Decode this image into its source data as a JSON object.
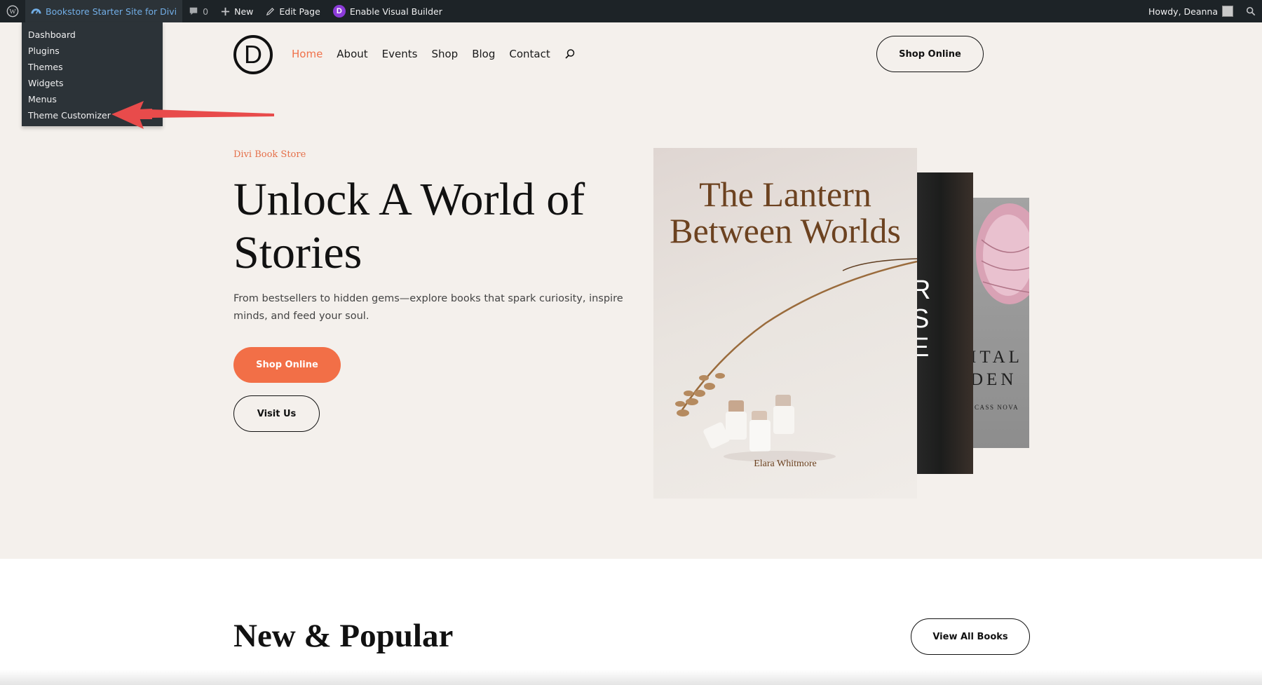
{
  "admin_bar": {
    "site_name": "Bookstore Starter Site for Divi",
    "comments_count": "0",
    "new_label": "New",
    "edit_page_label": "Edit Page",
    "visual_builder_label": "Enable Visual Builder",
    "greeting": "Howdy, Deanna"
  },
  "site_menu": {
    "items": [
      "Dashboard",
      "Plugins",
      "Themes",
      "Widgets",
      "Menus",
      "Theme Customizer"
    ]
  },
  "header": {
    "logo_letter": "D",
    "nav": [
      "Home",
      "About",
      "Events",
      "Shop",
      "Blog",
      "Contact"
    ],
    "active_nav": "Home",
    "cta_label": "Shop Online"
  },
  "hero": {
    "eyebrow": "Divi Book Store",
    "title": "Unlock A World of Stories",
    "text": "From bestsellers to hidden gems—explore books that spark curiosity, inspire minds, and feed your soul.",
    "primary_button": "Shop Online",
    "secondary_button": "Visit Us"
  },
  "books": {
    "front": {
      "title": "The Lantern Between Worlds",
      "author": "Elara Whitmore"
    },
    "middle": {
      "letters": "R\nS\nE"
    },
    "back": {
      "title_fragment": "ITAL\nDEN",
      "author": "CASS NOVA"
    }
  },
  "new_popular": {
    "title": "New & Popular",
    "button": "View All Books"
  },
  "colors": {
    "accent": "#f26f47",
    "admin_bar_bg": "#1d2327",
    "page_bg": "#f4f0ec",
    "arrow": "#e84b4b"
  }
}
